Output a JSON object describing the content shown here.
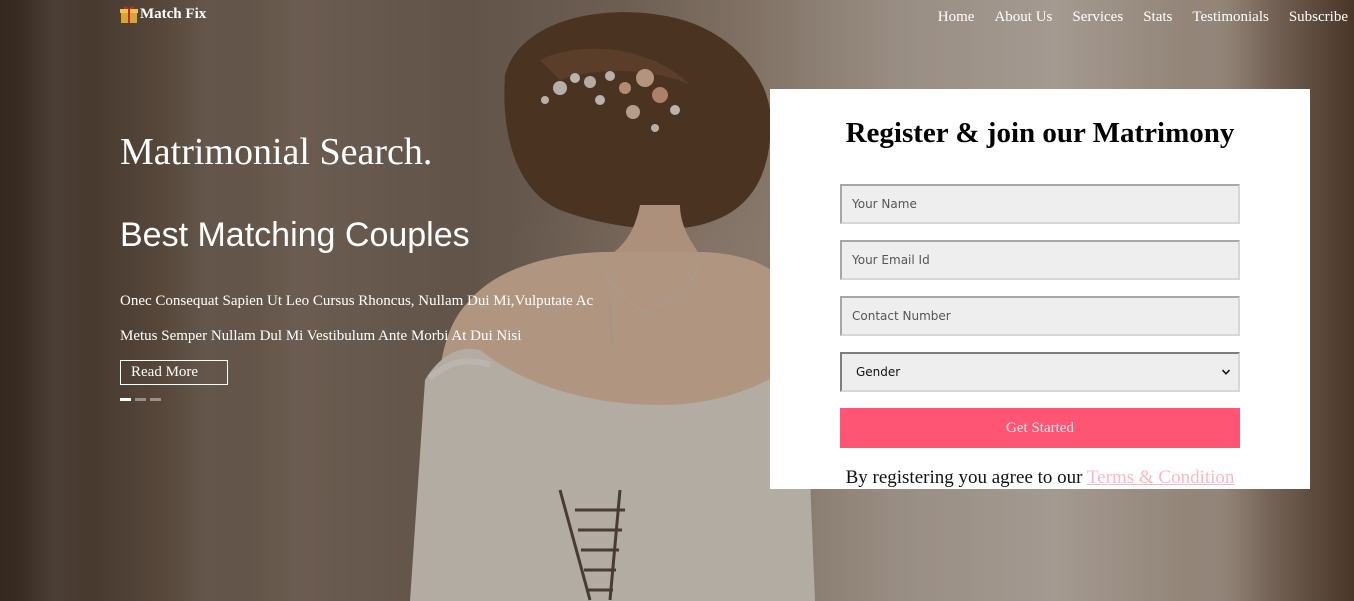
{
  "brand": {
    "name": "Match Fix",
    "icon": "gift-icon"
  },
  "nav": {
    "items": [
      {
        "label": "Home"
      },
      {
        "label": "About Us"
      },
      {
        "label": "Services"
      },
      {
        "label": "Stats"
      },
      {
        "label": "Testimonials"
      },
      {
        "label": "Subscribe"
      }
    ]
  },
  "hero": {
    "title": "Matrimonial Search.",
    "subtitle": "Best Matching Couples",
    "text_line1": "Onec Consequat Sapien Ut Leo Cursus Rhoncus, Nullam Dui Mi,Vulputate Ac",
    "text_line2": "Metus Semper Nullam Dul Mi Vestibulum Ante Morbi At Dui Nisi",
    "read_more_label": "Read More",
    "slider": {
      "slide_count": 3,
      "active_index": 0
    }
  },
  "form": {
    "title": "Register & join our Matrimony",
    "name_placeholder": "Your Name",
    "email_placeholder": "Your Email Id",
    "contact_placeholder": "Contact Number",
    "gender_value": "Gender",
    "submit_label": "Get Started",
    "agree_text": "By registering you agree to our",
    "terms_label": "Terms & Condition"
  },
  "colors": {
    "accent": "#ff5574",
    "link": "#ffb6c4",
    "field_bg": "#eeeeee"
  }
}
